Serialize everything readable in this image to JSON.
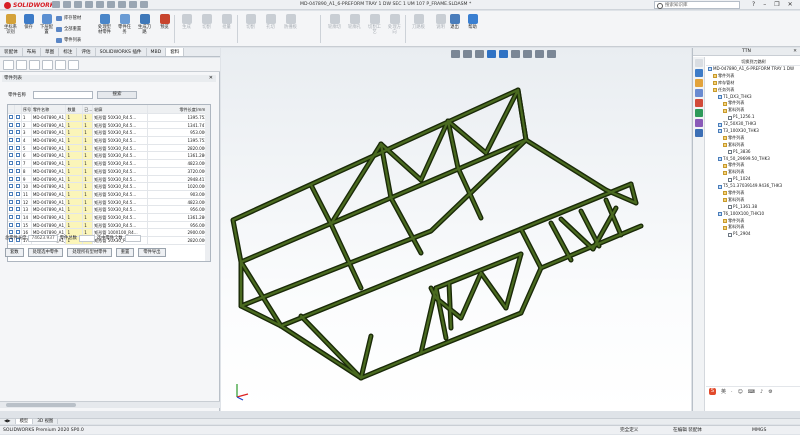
{
  "app": {
    "name": "SOLIDWORKS",
    "document_title": "MD-047890_A1_6-PREFORM TRAY 1 DW SEC 1 UM 107 P_FRAME.SLDASM *"
  },
  "search": {
    "placeholder": "搜索知识库"
  },
  "ribbon": {
    "buttons": [
      {
        "label": "坐标系识别",
        "state": "enabled"
      },
      {
        "label": "保存",
        "state": "enabled"
      },
      {
        "label": "下层配置",
        "state": "enabled"
      },
      {
        "label": "库存管材",
        "state": "enabled"
      },
      {
        "label": "全部重置",
        "state": "enabled"
      },
      {
        "label": "零件列表",
        "state": "enabled"
      },
      {
        "label": "处理型材零件",
        "state": "enabled"
      },
      {
        "label": "零件任务",
        "state": "enabled"
      },
      {
        "label": "生成刀路",
        "state": "enabled"
      },
      {
        "label": "预览",
        "state": "enabled"
      },
      {
        "label": "生成",
        "state": "disabled"
      },
      {
        "label": "切割",
        "state": "disabled"
      },
      {
        "label": "批量",
        "state": "disabled"
      },
      {
        "label": "切割",
        "state": "disabled"
      },
      {
        "label": "孔切",
        "state": "disabled"
      },
      {
        "label": "防撞板",
        "state": "disabled"
      },
      {
        "label": "轮廓切",
        "state": "disabled"
      },
      {
        "label": "轮廓孔",
        "state": "disabled"
      },
      {
        "label": "切割工艺",
        "state": "disabled"
      },
      {
        "label": "处理方向",
        "state": "disabled"
      },
      {
        "label": "刀路板",
        "state": "disabled"
      },
      {
        "label": "说明",
        "state": "disabled"
      },
      {
        "label": "退出",
        "state": "enabled"
      },
      {
        "label": "帮助",
        "state": "enabled"
      }
    ]
  },
  "tabs": [
    "装配体",
    "布局",
    "草图",
    "标注",
    "评估",
    "SOLIDWORKS 插件",
    "MBD",
    "套料"
  ],
  "left_panel": {
    "header": "零件列表",
    "search_label": "零件名称",
    "search_input": "",
    "search_button": "搜索",
    "columns": [
      "",
      "序号",
      "零件名称",
      "数量",
      "已...",
      "轮廓",
      "零件长度(mm)"
    ],
    "rows": [
      {
        "idx": "1",
        "name": "MD-047890_A1_6-...",
        "qty": "1",
        "done": "1",
        "profile": "矩形管 50X30_R4.5...",
        "length": "1395.752"
      },
      {
        "idx": "2",
        "name": "MD-047890_A1_6-...",
        "qty": "1",
        "done": "1",
        "profile": "矩形管 50X30_R4.5...",
        "length": "1341.747"
      },
      {
        "idx": "3",
        "name": "MD-047890_A1_6-...",
        "qty": "1",
        "done": "1",
        "profile": "矩形管 50X30_R4.5...",
        "length": "953.000"
      },
      {
        "idx": "4",
        "name": "MD-047890_A1_6-...",
        "qty": "1",
        "done": "1",
        "profile": "矩形管 50X30_R4.5...",
        "length": "1395.752"
      },
      {
        "idx": "5",
        "name": "MD-047890_A1_6-...",
        "qty": "1",
        "done": "1",
        "profile": "矩形管 50X30_R4.5...",
        "length": "2820.000"
      },
      {
        "idx": "6",
        "name": "MD-047890_A1_6-...",
        "qty": "1",
        "done": "1",
        "profile": "矩形管 50X30_R4.5...",
        "length": "1361.286"
      },
      {
        "idx": "7",
        "name": "MD-047890_A1_6-...",
        "qty": "1",
        "done": "1",
        "profile": "矩形管 50X30_R4.5...",
        "length": "4823.000"
      },
      {
        "idx": "8",
        "name": "MD-047890_A1_6-...",
        "qty": "1",
        "done": "1",
        "profile": "矩形管 50X30_R4.5...",
        "length": "3720.000"
      },
      {
        "idx": "9",
        "name": "MD-047890_A1_6-...",
        "qty": "1",
        "done": "1",
        "profile": "矩形管 50X30_R4.5...",
        "length": "2948.411"
      },
      {
        "idx": "10",
        "name": "MD-047890_A1_6-...",
        "qty": "1",
        "done": "1",
        "profile": "矩形管 50X30_R4.5...",
        "length": "1020.000"
      },
      {
        "idx": "11",
        "name": "MD-047890_A1_6-...",
        "qty": "1",
        "done": "1",
        "profile": "矩形管 50X30_R4.5...",
        "length": "903.000"
      },
      {
        "idx": "12",
        "name": "MD-047890_A1_6-...",
        "qty": "1",
        "done": "1",
        "profile": "矩形管 50X30_R4.5...",
        "length": "4823.000"
      },
      {
        "idx": "13",
        "name": "MD-047890_A1_6-...",
        "qty": "1",
        "done": "1",
        "profile": "矩形管 50X30_R4.5...",
        "length": "956.000"
      },
      {
        "idx": "14",
        "name": "MD-047890_A1_6-...",
        "qty": "1",
        "done": "1",
        "profile": "矩形管 50X30_R4.5...",
        "length": "1361.286"
      },
      {
        "idx": "15",
        "name": "MD-047890_A1_6-...",
        "qty": "1",
        "done": "1",
        "profile": "矩形管 50X30_R4.5...",
        "length": "956.000"
      },
      {
        "idx": "16",
        "name": "MD-047890_A1_6-...",
        "qty": "1",
        "done": "1",
        "profile": "矩形管 100X100_R4...",
        "length": "2900.000"
      },
      {
        "idx": "17",
        "name": "MD-047890_A1_6-...",
        "qty": "1",
        "done": "1",
        "profile": "矩形管 50X30_R4.5...",
        "length": "2820.000"
      }
    ],
    "stats": {
      "total_length_label": "总零件长度",
      "total_length_value": "74623.937",
      "count_label": "零件总数",
      "count_value": "",
      "selected_label": "选中零件个数",
      "selected_value": ""
    },
    "buttons": [
      "套数",
      "处理选中零件",
      "处理所有型材零件",
      "重置",
      "零件导出"
    ]
  },
  "right_panel": {
    "title": "TTN",
    "subtitle": "切换到刀路树",
    "tree": [
      {
        "label": "MD-047890_A1_6-PREFORM TRAY 1 DW",
        "level": 0,
        "type": "asm"
      },
      {
        "label": "零件列表",
        "level": 1,
        "type": "folder"
      },
      {
        "label": "库存管材",
        "level": 1,
        "type": "folder"
      },
      {
        "label": "任务列表",
        "level": 1,
        "type": "folder"
      },
      {
        "label": "T1_DX3_THK3",
        "level": 2,
        "type": "task"
      },
      {
        "label": "零件列表",
        "level": 3,
        "type": "folder"
      },
      {
        "label": "套料列表",
        "level": 3,
        "type": "folder"
      },
      {
        "label": "P1_1256.1",
        "level": 4,
        "type": "item"
      },
      {
        "label": "T2_50X30_THK3",
        "level": 2,
        "type": "task"
      },
      {
        "label": "T3_100X30_THK3",
        "level": 2,
        "type": "task"
      },
      {
        "label": "零件列表",
        "level": 3,
        "type": "folder"
      },
      {
        "label": "套料列表",
        "level": 3,
        "type": "folder"
      },
      {
        "label": "P1_3836",
        "level": 4,
        "type": "item"
      },
      {
        "label": "T4_50_29699.50_THK3",
        "level": 2,
        "type": "task"
      },
      {
        "label": "零件列表",
        "level": 3,
        "type": "folder"
      },
      {
        "label": "套料列表",
        "level": 3,
        "type": "folder"
      },
      {
        "label": "P1_1024",
        "level": 4,
        "type": "item"
      },
      {
        "label": "T5_51.37039149.9436_THK3",
        "level": 2,
        "type": "task"
      },
      {
        "label": "零件列表",
        "level": 3,
        "type": "folder"
      },
      {
        "label": "套料列表",
        "level": 3,
        "type": "folder"
      },
      {
        "label": "P1_1361.38",
        "level": 4,
        "type": "item"
      },
      {
        "label": "T6_100X100_THK10",
        "level": 2,
        "type": "task"
      },
      {
        "label": "零件列表",
        "level": 3,
        "type": "folder"
      },
      {
        "label": "套料列表",
        "level": 3,
        "type": "folder"
      },
      {
        "label": "P1_2904",
        "level": 4,
        "type": "item"
      }
    ]
  },
  "ime_bar": {
    "label": "S",
    "items": [
      "英",
      "·",
      "☺",
      "⌨",
      "♪",
      "⚙"
    ]
  },
  "bottom_tabs": [
    "模型",
    "3D 视图"
  ],
  "status": {
    "left": "SOLIDWORKS Premium 2020 SP0.0",
    "mid1": "完全定义",
    "mid2": "在编辑 装配体",
    "right": "MMGS"
  },
  "colors": {
    "frame": "#2e4a12",
    "accent": "#d71f26",
    "selection": "#fbf5b9"
  }
}
